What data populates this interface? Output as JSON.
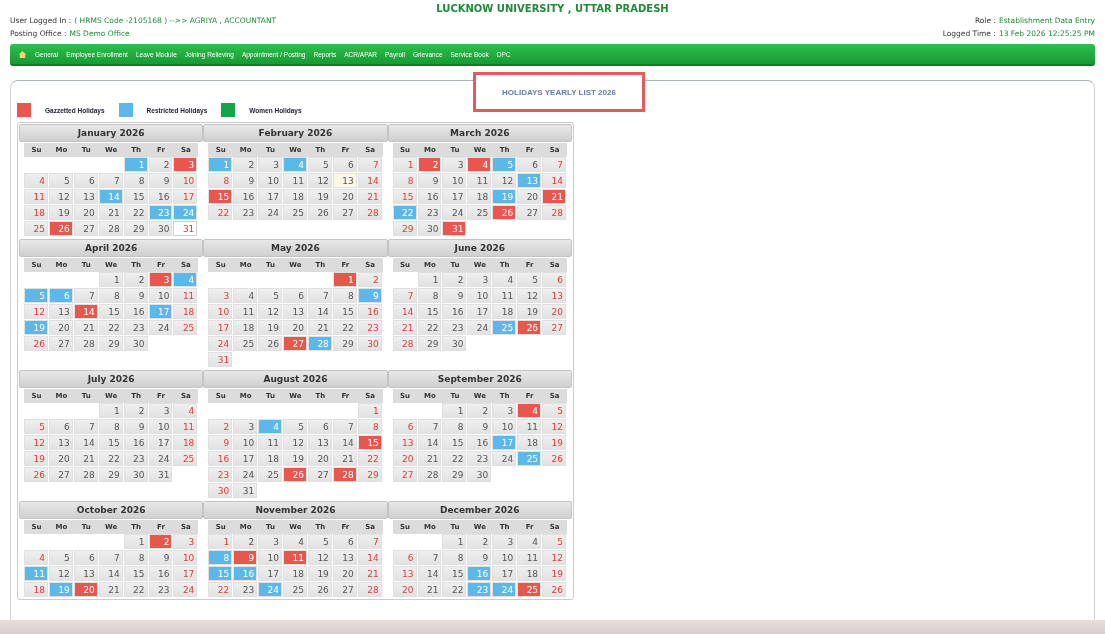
{
  "header": {
    "title": "LUCKNOW UNIVERSITY , UTTAR PRADESH",
    "user": {
      "label": "User Logged In :",
      "value": "( HRMS Code -2105168 ) -->> AGRIYA , ACCOUNTANT"
    },
    "role": {
      "label": "Role :",
      "value": "Establishment Data Entry"
    },
    "office": {
      "label": "Posting Office :",
      "value": "MS Demo Office"
    },
    "time": {
      "label": "Logged Time :",
      "value": "13 Feb 2026 12:25:25 PM"
    }
  },
  "menu": [
    "General",
    "Employee Enrollment",
    "Leave Module",
    "Joining Relieving",
    "Appointment / Posting",
    "Reports",
    "ACR/APAR",
    "Payroll",
    "Grievance",
    "Service Book",
    "DPC"
  ],
  "page_title": "HOLIDAYS YEARLY LIST 2026",
  "legend": [
    {
      "label": "Gazzetted Holidays",
      "color": "#e8574e"
    },
    {
      "label": "Restricted Holidays",
      "color": "#5bb8e8"
    },
    {
      "label": "Women Holidays",
      "color": "#16a34a"
    }
  ],
  "months": [
    {
      "title": "January 2026",
      "weekdays": [
        "Su",
        "Mo",
        "Tu",
        "We",
        "Th",
        "Fr",
        "Sa"
      ],
      "weeks": [
        [
          {
            "day": "1",
            "kind": "restricted"
          },
          "2",
          {
            "day": "3",
            "kind": "gazetted"
          }
        ],
        [
          "4",
          "5",
          "6",
          "7",
          "8",
          "9",
          "10"
        ],
        [
          "11",
          "12",
          "13",
          {
            "day": "14",
            "kind": "restricted"
          },
          "15",
          "16",
          "17"
        ],
        [
          "18",
          "19",
          "20",
          "21",
          "22",
          {
            "day": "23",
            "kind": "restricted"
          },
          {
            "day": "24",
            "kind": "restricted"
          }
        ],
        [
          "25",
          {
            "day": "26",
            "kind": "gazetted"
          },
          "27",
          "28",
          "29",
          "30",
          {
            "day": "31",
            "kind": "plain"
          }
        ]
      ]
    },
    {
      "title": "February 2026",
      "weekdays": [
        "Su",
        "Mo",
        "Tu",
        "We",
        "Th",
        "Fr",
        "Sa"
      ],
      "weeks": [
        [
          {
            "day": "1",
            "kind": "restricted"
          },
          "2",
          "3",
          {
            "day": "4",
            "kind": "restricted"
          },
          "5",
          "6",
          "7"
        ],
        [
          "8",
          "9",
          "10",
          "11",
          "12",
          {
            "day": "13",
            "kind": "today"
          },
          "14"
        ],
        [
          {
            "day": "15",
            "kind": "gazetted"
          },
          "16",
          "17",
          "18",
          "19",
          "20",
          "21"
        ],
        [
          "22",
          "23",
          "24",
          "25",
          "26",
          "27",
          "28"
        ]
      ]
    },
    {
      "title": "March 2026",
      "weekdays": [
        "Su",
        "Mo",
        "Tu",
        "We",
        "Th",
        "Fr",
        "Sa"
      ],
      "weeks": [
        [
          "1",
          {
            "day": "2",
            "kind": "gazetted"
          },
          "3",
          {
            "day": "4",
            "kind": "gazetted"
          },
          {
            "day": "5",
            "kind": "restricted"
          },
          "6",
          "7"
        ],
        [
          "8",
          "9",
          "10",
          "11",
          "12",
          {
            "day": "13",
            "kind": "restricted"
          },
          "14"
        ],
        [
          "15",
          "16",
          "17",
          "18",
          {
            "day": "19",
            "kind": "restricted"
          },
          "20",
          {
            "day": "21",
            "kind": "gazetted"
          }
        ],
        [
          {
            "day": "22",
            "kind": "restricted"
          },
          "23",
          "24",
          "25",
          {
            "day": "26",
            "kind": "gazetted"
          },
          "27",
          "28"
        ],
        [
          "29",
          "30",
          {
            "day": "31",
            "kind": "gazetted"
          }
        ]
      ]
    },
    {
      "title": "April 2026",
      "weekdays": [
        "Su",
        "Mo",
        "Tu",
        "We",
        "Th",
        "Fr",
        "Sa"
      ],
      "weeks": [
        [
          "1",
          "2",
          {
            "day": "3",
            "kind": "gazetted"
          },
          {
            "day": "4",
            "kind": "restricted"
          }
        ],
        [
          {
            "day": "5",
            "kind": "restricted"
          },
          {
            "day": "6",
            "kind": "restricted"
          },
          "7",
          "8",
          "9",
          "10",
          "11"
        ],
        [
          "12",
          "13",
          {
            "day": "14",
            "kind": "gazetted"
          },
          "15",
          "16",
          {
            "day": "17",
            "kind": "restricted"
          },
          "18"
        ],
        [
          {
            "day": "19",
            "kind": "restricted"
          },
          "20",
          "21",
          "22",
          "23",
          "24",
          "25"
        ],
        [
          "26",
          "27",
          "28",
          "29",
          "30"
        ]
      ]
    },
    {
      "title": "May 2026",
      "weekdays": [
        "Su",
        "Mo",
        "Tu",
        "We",
        "Th",
        "Fr",
        "Sa"
      ],
      "weeks": [
        [
          {
            "day": "1",
            "kind": "gazetted"
          },
          "2"
        ],
        [
          "3",
          "4",
          "5",
          "6",
          "7",
          "8",
          {
            "day": "9",
            "kind": "restricted"
          }
        ],
        [
          "10",
          "11",
          "12",
          "13",
          "14",
          "15",
          "16"
        ],
        [
          "17",
          "18",
          "19",
          "20",
          "21",
          "22",
          "23"
        ],
        [
          "24",
          "25",
          "26",
          {
            "day": "27",
            "kind": "gazetted"
          },
          {
            "day": "28",
            "kind": "restricted"
          },
          "29",
          "30"
        ],
        [
          "31"
        ]
      ]
    },
    {
      "title": "June 2026",
      "weekdays": [
        "Su",
        "Mo",
        "Tu",
        "We",
        "Th",
        "Fr",
        "Sa"
      ],
      "weeks": [
        [
          "1",
          "2",
          "3",
          "4",
          "5",
          "6"
        ],
        [
          "7",
          "8",
          "9",
          "10",
          "11",
          "12",
          "13"
        ],
        [
          "14",
          "15",
          "16",
          "17",
          "18",
          "19",
          "20"
        ],
        [
          "21",
          "22",
          "23",
          "24",
          {
            "day": "25",
            "kind": "restricted"
          },
          {
            "day": "26",
            "kind": "gazetted"
          },
          "27"
        ],
        [
          "28",
          "29",
          "30"
        ]
      ]
    },
    {
      "title": "July 2026",
      "weekdays": [
        "Su",
        "Mo",
        "Tu",
        "We",
        "Th",
        "Fr",
        "Sa"
      ],
      "weeks": [
        [
          "1",
          "2",
          "3",
          "4"
        ],
        [
          "5",
          "6",
          "7",
          "8",
          "9",
          "10",
          "11"
        ],
        [
          "12",
          "13",
          "14",
          "15",
          "16",
          "17",
          "18"
        ],
        [
          "19",
          "20",
          "21",
          "22",
          "23",
          "24",
          "25"
        ],
        [
          "26",
          "27",
          "28",
          "29",
          "30",
          "31"
        ]
      ]
    },
    {
      "title": "August 2026",
      "weekdays": [
        "Su",
        "Mo",
        "Tu",
        "We",
        "Th",
        "Fr",
        "Sa"
      ],
      "weeks": [
        [
          "1"
        ],
        [
          "2",
          "3",
          {
            "day": "4",
            "kind": "restricted"
          },
          "5",
          "6",
          "7",
          "8"
        ],
        [
          "9",
          "10",
          "11",
          "12",
          "13",
          "14",
          {
            "day": "15",
            "kind": "gazetted"
          }
        ],
        [
          "16",
          "17",
          "18",
          "19",
          "20",
          "21",
          "22"
        ],
        [
          "23",
          "24",
          "25",
          {
            "day": "26",
            "kind": "gazetted"
          },
          "27",
          {
            "day": "28",
            "kind": "gazetted"
          },
          "29"
        ],
        [
          "30",
          "31"
        ]
      ]
    },
    {
      "title": "September 2026",
      "weekdays": [
        "Su",
        "Mo",
        "Tu",
        "We",
        "Th",
        "Fr",
        "Sa"
      ],
      "weeks": [
        [
          "1",
          "2",
          "3",
          {
            "day": "4",
            "kind": "gazetted"
          },
          "5"
        ],
        [
          "6",
          "7",
          "8",
          "9",
          "10",
          "11",
          "12"
        ],
        [
          "13",
          "14",
          "15",
          "16",
          {
            "day": "17",
            "kind": "restricted"
          },
          "18",
          "19"
        ],
        [
          "20",
          "21",
          "22",
          "23",
          "24",
          {
            "day": "25",
            "kind": "restricted"
          },
          "26"
        ],
        [
          "27",
          "28",
          "29",
          "30"
        ]
      ]
    },
    {
      "title": "October 2026",
      "weekdays": [
        "Su",
        "Mo",
        "Tu",
        "We",
        "Th",
        "Fr",
        "Sa"
      ],
      "weeks": [
        [
          "1",
          {
            "day": "2",
            "kind": "gazetted"
          },
          "3"
        ],
        [
          "4",
          "5",
          "6",
          "7",
          "8",
          "9",
          "10"
        ],
        [
          {
            "day": "11",
            "kind": "restricted"
          },
          "12",
          "13",
          "14",
          "15",
          "16",
          "17"
        ],
        [
          "18",
          {
            "day": "19",
            "kind": "restricted"
          },
          {
            "day": "20",
            "kind": "gazetted"
          },
          "21",
          "22",
          "23",
          "24"
        ]
      ]
    },
    {
      "title": "November 2026",
      "weekdays": [
        "Su",
        "Mo",
        "Tu",
        "We",
        "Th",
        "Fr",
        "Sa"
      ],
      "weeks": [
        [
          "1",
          "2",
          "3",
          "4",
          "5",
          "6",
          "7"
        ],
        [
          {
            "day": "8",
            "kind": "restricted"
          },
          {
            "day": "9",
            "kind": "gazetted"
          },
          "10",
          {
            "day": "11",
            "kind": "gazetted"
          },
          "12",
          "13",
          "14"
        ],
        [
          {
            "day": "15",
            "kind": "restricted"
          },
          {
            "day": "16",
            "kind": "restricted"
          },
          "17",
          "18",
          "19",
          "20",
          "21"
        ],
        [
          "22",
          "23",
          {
            "day": "24",
            "kind": "restricted"
          },
          "25",
          "26",
          "27",
          "28"
        ]
      ]
    },
    {
      "title": "December 2026",
      "weekdays": [
        "Su",
        "Mo",
        "Tu",
        "We",
        "Th",
        "Fr",
        "Sa"
      ],
      "weeks": [
        [
          "1",
          "2",
          "3",
          "4",
          "5"
        ],
        [
          "6",
          "7",
          "8",
          "9",
          "10",
          "11",
          "12"
        ],
        [
          "13",
          "14",
          "15",
          {
            "day": "16",
            "kind": "restricted"
          },
          "17",
          "18",
          "19"
        ],
        [
          "20",
          "21",
          "22",
          {
            "day": "23",
            "kind": "restricted"
          },
          {
            "day": "24",
            "kind": "restricted"
          },
          {
            "day": "25",
            "kind": "gazetted"
          },
          "26"
        ]
      ]
    }
  ]
}
